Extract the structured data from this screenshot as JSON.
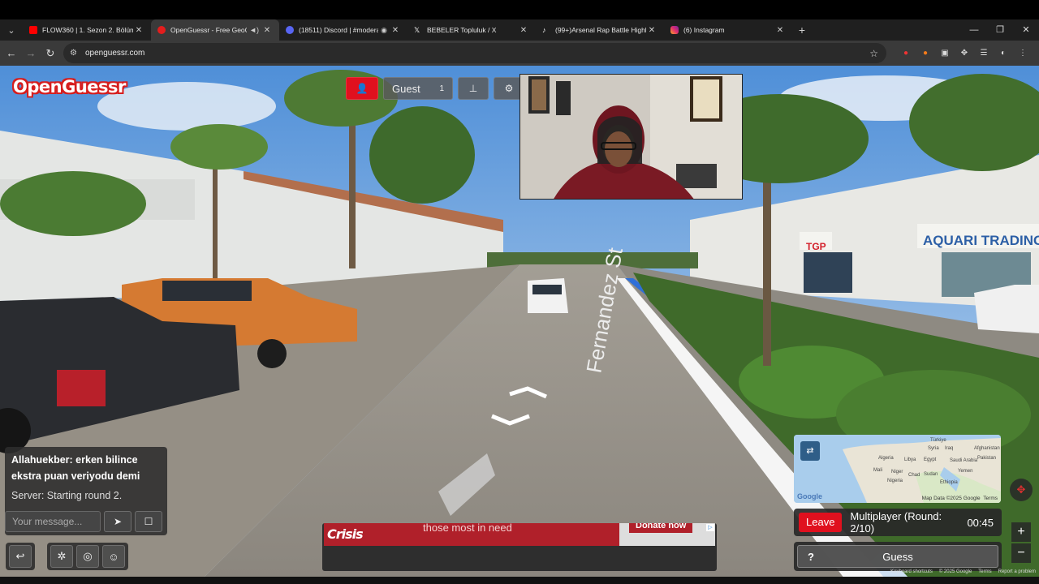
{
  "browser": {
    "tabs": [
      {
        "title": "FLOW360 | 1. Sezon 2. Bölüm -",
        "favicon_color": "#ff0000",
        "active": false,
        "extra": ""
      },
      {
        "title": "OpenGuessr - Free GeoGu",
        "favicon_color": "#e31d1d",
        "active": true,
        "extra": "speaker"
      },
      {
        "title": "(18511) Discord | #moderati",
        "favicon_color": "#5865f2",
        "active": false,
        "extra": "record"
      },
      {
        "title": "BEBELER Topluluk / X",
        "favicon_color": "#ffffff",
        "active": false,
        "extra": ""
      },
      {
        "title": "(99+)Arsenal Rap Battle Highlig",
        "favicon_color": "#111111",
        "active": false,
        "extra": ""
      },
      {
        "title": "(6) Instagram",
        "favicon_color": "#e1306c",
        "active": false,
        "extra": ""
      }
    ],
    "url": "openguessr.com"
  },
  "game": {
    "logo": "OpenGuessr",
    "guest_label": "Guest",
    "guest_count": "1",
    "chat": {
      "message": "Allahuekber: erken bilince ekstra puan veriyodu demi",
      "system": "Server: Starting round 2.",
      "input_placeholder": "Your message..."
    },
    "street_sign": "Fernandez St",
    "storefront_1": "TGP",
    "storefront_2": "AQUARI TRADING",
    "status": {
      "leave_label": "Leave",
      "round_label": "Multiplayer (Round: 2/10)",
      "timer": "00:45"
    },
    "guess_label": "Guess",
    "guess_hint": "?",
    "map": {
      "attribution": "Map Data ©2025 Google",
      "terms": "Terms",
      "google": "Google",
      "labels": [
        "Türkiye",
        "Syria",
        "Iraq",
        "Afghanistan",
        "Algeria",
        "Libya",
        "Egypt",
        "Saudi Arabia",
        "Pakistan",
        "Mali",
        "Niger",
        "Chad",
        "Sudan",
        "Yemen",
        "Nigeria",
        "Ethiopia"
      ]
    },
    "ad": {
      "brand": "Crisis",
      "tagline": "those most in need",
      "cta": "Donate now"
    },
    "footer": [
      "Keyboard shortcuts",
      "© 2025 Google",
      "Terms",
      "Report a problem"
    ]
  },
  "colors": {
    "brand_red": "#e0101e",
    "tab_active": "#3a3a3a"
  }
}
